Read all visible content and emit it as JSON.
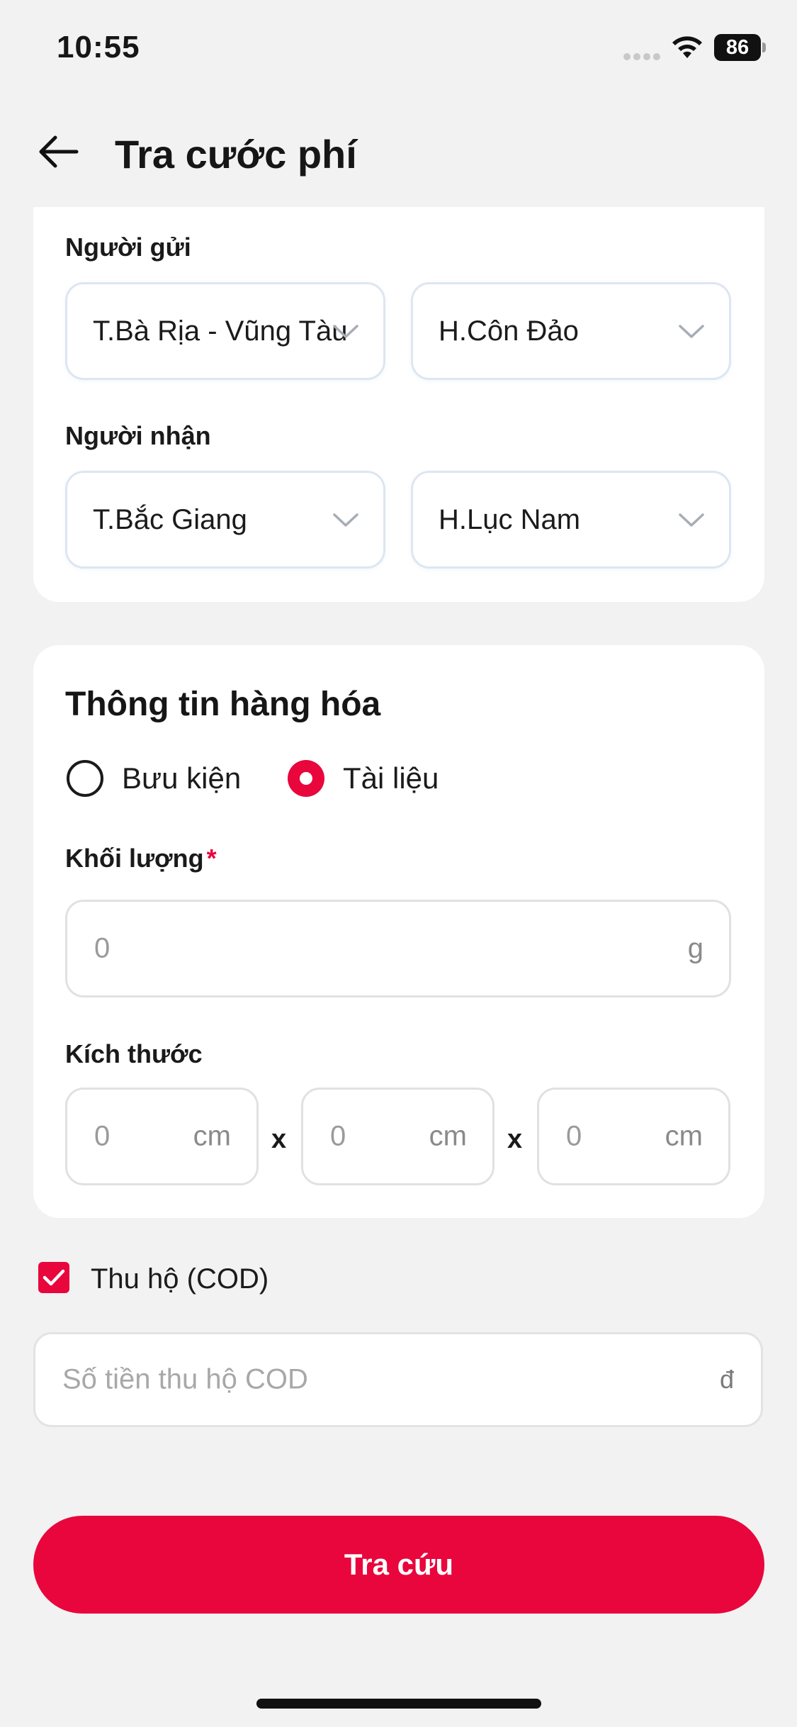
{
  "status_bar": {
    "time": "10:55",
    "battery": "86"
  },
  "header": {
    "title": "Tra cước phí",
    "back_icon": "arrow-left-icon"
  },
  "sender": {
    "label": "Người gửi",
    "province": "T.Bà Rịa - Vũng Tàu",
    "district": "H.Côn Đảo"
  },
  "receiver": {
    "label": "Người nhận",
    "province": "T.Bắc Giang",
    "district": "H.Lục Nam"
  },
  "goods": {
    "title": "Thông tin hàng hóa",
    "types": [
      {
        "label": "Bưu kiện",
        "selected": false
      },
      {
        "label": "Tài liệu",
        "selected": true
      }
    ],
    "weight": {
      "label": "Khối lượng",
      "required_mark": "*",
      "placeholder": "0",
      "unit": "g"
    },
    "dimensions": {
      "label": "Kích thước",
      "separator": "x",
      "fields": [
        {
          "placeholder": "0",
          "unit": "cm"
        },
        {
          "placeholder": "0",
          "unit": "cm"
        },
        {
          "placeholder": "0",
          "unit": "cm"
        }
      ]
    }
  },
  "cod": {
    "checked": true,
    "label": "Thu hộ (COD)",
    "placeholder": "Số tiền thu hộ COD",
    "unit": "đ"
  },
  "submit_label": "Tra cứu",
  "colors": {
    "accent": "#e8063c",
    "background": "#f2f2f2",
    "card": "#ffffff"
  }
}
